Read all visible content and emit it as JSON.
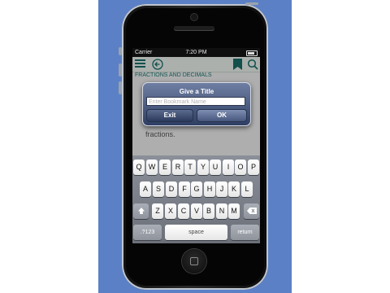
{
  "status_bar": {
    "carrier": "Carrier",
    "time": "7:20 PM"
  },
  "toolbar": {
    "menu_icon": "menu-icon",
    "back_icon": "back-arrow-icon",
    "bookmark_icon": "bookmark-icon",
    "search_icon": "search-icon"
  },
  "subtitle": "FRACTIONS AND DECIMALS",
  "content": {
    "text": "fractions."
  },
  "dialog": {
    "title": "Give a Title",
    "input_placeholder": "Enter Bookmark Name",
    "exit_label": "Exit",
    "ok_label": "OK"
  },
  "keyboard": {
    "row1": [
      "Q",
      "W",
      "E",
      "R",
      "T",
      "Y",
      "U",
      "I",
      "O",
      "P"
    ],
    "row2": [
      "A",
      "S",
      "D",
      "F",
      "G",
      "H",
      "J",
      "K",
      "L"
    ],
    "row3": [
      "Z",
      "X",
      "C",
      "V",
      "B",
      "N",
      "M"
    ],
    "shift_icon": "shift-icon",
    "delete_icon": "delete-icon",
    "numbers_label": ".?123",
    "space_label": "space",
    "return_label": "return"
  },
  "colors": {
    "background": "#5b80c6",
    "accent": "#1b6f6a",
    "dialog": "#3c4b70"
  }
}
